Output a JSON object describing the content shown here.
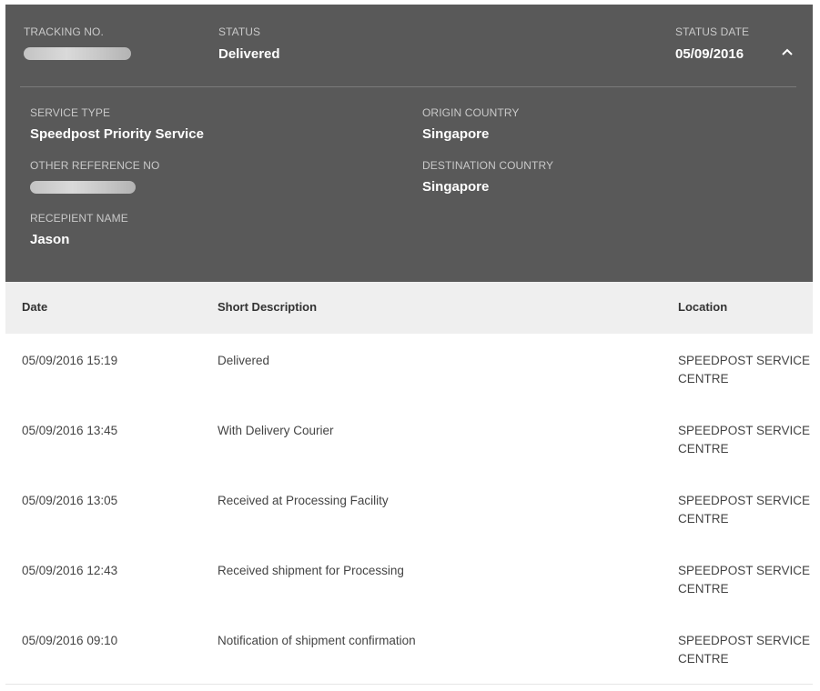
{
  "summary": {
    "tracking_no_label": "TRACKING NO.",
    "status_label": "STATUS",
    "status_value": "Delivered",
    "status_date_label": "STATUS DATE",
    "status_date_value": "05/09/2016",
    "toggle_icon": "chevron-up-icon"
  },
  "details": {
    "service_type_label": "SERVICE TYPE",
    "service_type_value": "Speedpost Priority Service",
    "origin_country_label": "ORIGIN COUNTRY",
    "origin_country_value": "Singapore",
    "other_reference_label": "OTHER REFERENCE NO",
    "destination_country_label": "DESTINATION COUNTRY",
    "destination_country_value": "Singapore",
    "recipient_label": "RECEPIENT NAME",
    "recipient_value": "Jason"
  },
  "table": {
    "headers": [
      "Date",
      "Short Description",
      "Location"
    ],
    "rows": [
      {
        "date": "05/09/2016 15:19",
        "desc": "Delivered",
        "loc": "SPEEDPOST SERVICE CENTRE"
      },
      {
        "date": "05/09/2016 13:45",
        "desc": "With Delivery Courier",
        "loc": "SPEEDPOST SERVICE CENTRE"
      },
      {
        "date": "05/09/2016 13:05",
        "desc": "Received at Processing Facility",
        "loc": "SPEEDPOST SERVICE CENTRE"
      },
      {
        "date": "05/09/2016 12:43",
        "desc": "Received shipment for Processing",
        "loc": "SPEEDPOST SERVICE CENTRE"
      },
      {
        "date": "05/09/2016 09:10",
        "desc": "Notification of shipment confirmation",
        "loc": "SPEEDPOST SERVICE CENTRE"
      }
    ]
  }
}
